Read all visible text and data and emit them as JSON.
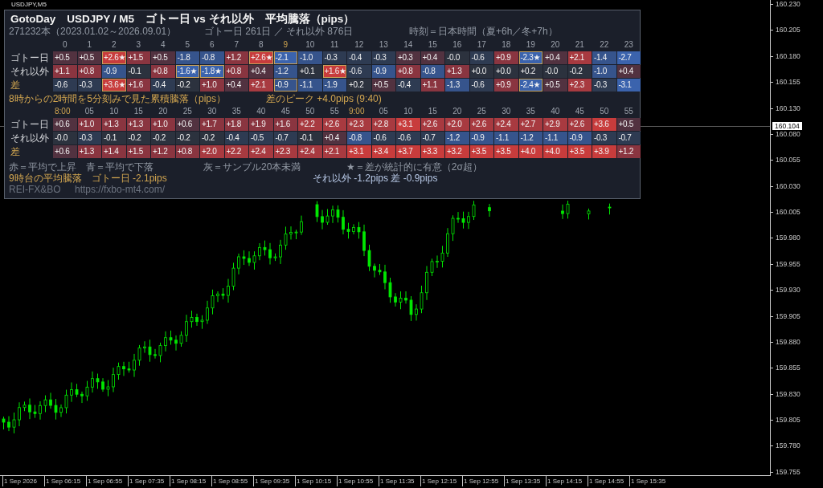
{
  "chart": {
    "symbol": "USDJPY,M5",
    "price_axis": [
      "160.230",
      "160.205",
      "160.180",
      "160.155",
      "160.130",
      "160.080",
      "160.055",
      "160.030",
      "160.005",
      "159.980",
      "159.955",
      "159.930",
      "159.905",
      "159.880",
      "159.855",
      "159.830",
      "159.805",
      "159.780",
      "159.755"
    ],
    "current_price": "160.104",
    "time_axis": [
      "1 Sep 2026",
      "1 Sep 06:15",
      "1 Sep 06:55",
      "1 Sep 07:35",
      "1 Sep 08:15",
      "1 Sep 08:55",
      "1 Sep 09:35",
      "1 Sep 10:15",
      "1 Sep 10:55",
      "1 Sep 11:35",
      "1 Sep 12:15",
      "1 Sep 12:55",
      "1 Sep 13:35",
      "1 Sep 14:15",
      "1 Sep 14:55",
      "1 Sep 15:35"
    ]
  },
  "panel": {
    "title": "GotoDay　USDJPY / M5　ゴトー日 vs それ以外　平均騰落（pips）",
    "bars": "271232本（2023.01.02～2026.09.01）",
    "days": "ゴトー日 261日 ／ それ以外 876日",
    "timezone": "時刻＝日本時間（夏+6h／冬+7h）",
    "hourly_table": {
      "columns": [
        {
          "label": "0",
          "highlighted": false
        },
        {
          "label": "1",
          "highlighted": false
        },
        {
          "label": "2",
          "highlighted": false
        },
        {
          "label": "3",
          "highlighted": false
        },
        {
          "label": "4",
          "highlighted": false
        },
        {
          "label": "5",
          "highlighted": false
        },
        {
          "label": "6",
          "highlighted": false
        },
        {
          "label": "7",
          "highlighted": false
        },
        {
          "label": "8",
          "highlighted": false
        },
        {
          "label": "9",
          "highlighted": true
        },
        {
          "label": "10",
          "highlighted": false
        },
        {
          "label": "11",
          "highlighted": false
        },
        {
          "label": "12",
          "highlighted": false
        },
        {
          "label": "13",
          "highlighted": false
        },
        {
          "label": "14",
          "highlighted": false
        },
        {
          "label": "15",
          "highlighted": false
        },
        {
          "label": "16",
          "highlighted": false
        },
        {
          "label": "17",
          "highlighted": false
        },
        {
          "label": "18",
          "highlighted": false
        },
        {
          "label": "19",
          "highlighted": false
        },
        {
          "label": "20",
          "highlighted": false
        },
        {
          "label": "21",
          "highlighted": false
        },
        {
          "label": "22",
          "highlighted": false
        },
        {
          "label": "23",
          "highlighted": false
        }
      ],
      "rows": [
        {
          "label": "ゴトー日",
          "highlighted": false,
          "cells": [
            {
              "text": "+0.5",
              "color": "#523240",
              "outlined": false
            },
            {
              "text": "+0.5",
              "color": "#523240",
              "outlined": false
            },
            {
              "text": "+2.6★",
              "color": "#c83c3c",
              "outlined": true
            },
            {
              "text": "+1.5",
              "color": "#8a3540",
              "outlined": false
            },
            {
              "text": "+0.5",
              "color": "#523240",
              "outlined": false
            },
            {
              "text": "-1.8",
              "color": "#36548c",
              "outlined": false
            },
            {
              "text": "-0.8",
              "color": "#36548c",
              "outlined": false
            },
            {
              "text": "+1.2",
              "color": "#8a3540",
              "outlined": false
            },
            {
              "text": "+2.6★",
              "color": "#c83c3c",
              "outlined": true
            },
            {
              "text": "-2.1",
              "color": "#3b63ad",
              "outlined": true
            },
            {
              "text": "-1.0",
              "color": "#36548c",
              "outlined": false
            },
            {
              "text": "-0.3",
              "color": "#2e3b52",
              "outlined": false
            },
            {
              "text": "-0.4",
              "color": "#2e3b52",
              "outlined": false
            },
            {
              "text": "-0.3",
              "color": "#2e3b52",
              "outlined": false
            },
            {
              "text": "+0.3",
              "color": "#523240",
              "outlined": false
            },
            {
              "text": "+0.4",
              "color": "#523240",
              "outlined": false
            },
            {
              "text": "-0.0",
              "color": "#2c323e",
              "outlined": false
            },
            {
              "text": "-0.6",
              "color": "#2e3b52",
              "outlined": false
            },
            {
              "text": "+0.9",
              "color": "#8a3540",
              "outlined": false
            },
            {
              "text": "-2.3★",
              "color": "#3b63ad",
              "outlined": true
            },
            {
              "text": "+0.4",
              "color": "#523240",
              "outlined": false
            },
            {
              "text": "+2.1",
              "color": "#a83a40",
              "outlined": false
            },
            {
              "text": "-1.4",
              "color": "#36548c",
              "outlined": false
            },
            {
              "text": "-2.7",
              "color": "#3b63ad",
              "outlined": false
            }
          ]
        },
        {
          "label": "それ以外",
          "highlighted": false,
          "cells": [
            {
              "text": "+1.1",
              "color": "#8a3540",
              "outlined": false
            },
            {
              "text": "+0.8",
              "color": "#8a3540",
              "outlined": false
            },
            {
              "text": "-0.9",
              "color": "#36548c",
              "outlined": false
            },
            {
              "text": "-0.1",
              "color": "#2c323e",
              "outlined": false
            },
            {
              "text": "+0.8",
              "color": "#8a3540",
              "outlined": false
            },
            {
              "text": "-1.6★",
              "color": "#3b63ad",
              "outlined": true
            },
            {
              "text": "-1.8★",
              "color": "#3b63ad",
              "outlined": true
            },
            {
              "text": "+0.8",
              "color": "#8a3540",
              "outlined": false
            },
            {
              "text": "+0.4",
              "color": "#523240",
              "outlined": false
            },
            {
              "text": "-1.2",
              "color": "#36548c",
              "outlined": false
            },
            {
              "text": "+0.1",
              "color": "#2c323e",
              "outlined": false
            },
            {
              "text": "+1.6★",
              "color": "#c83c3c",
              "outlined": true
            },
            {
              "text": "-0.6",
              "color": "#2e3b52",
              "outlined": false
            },
            {
              "text": "-0.9",
              "color": "#36548c",
              "outlined": false
            },
            {
              "text": "+0.8",
              "color": "#8a3540",
              "outlined": false
            },
            {
              "text": "-0.8",
              "color": "#36548c",
              "outlined": false
            },
            {
              "text": "+1.3",
              "color": "#8a3540",
              "outlined": false
            },
            {
              "text": "+0.0",
              "color": "#2c323e",
              "outlined": false
            },
            {
              "text": "+0.0",
              "color": "#2c323e",
              "outlined": false
            },
            {
              "text": "+0.2",
              "color": "#2c323e",
              "outlined": false
            },
            {
              "text": "-0.0",
              "color": "#2c323e",
              "outlined": false
            },
            {
              "text": "-0.2",
              "color": "#2c323e",
              "outlined": false
            },
            {
              "text": "-1.0",
              "color": "#36548c",
              "outlined": false
            },
            {
              "text": "+0.4",
              "color": "#523240",
              "outlined": false
            }
          ]
        },
        {
          "label": "差",
          "highlighted": true,
          "cells": [
            {
              "text": "-0.6",
              "color": "#2e3b52",
              "outlined": false
            },
            {
              "text": "-0.3",
              "color": "#2e3b52",
              "outlined": false
            },
            {
              "text": "+3.6★",
              "color": "#c83c3c",
              "outlined": true
            },
            {
              "text": "+1.6",
              "color": "#8a3540",
              "outlined": false
            },
            {
              "text": "-0.4",
              "color": "#2e3b52",
              "outlined": false
            },
            {
              "text": "-0.2",
              "color": "#2c323e",
              "outlined": false
            },
            {
              "text": "+1.0",
              "color": "#8a3540",
              "outlined": false
            },
            {
              "text": "+0.4",
              "color": "#523240",
              "outlined": false
            },
            {
              "text": "+2.1",
              "color": "#a83a40",
              "outlined": false
            },
            {
              "text": "-0.9",
              "color": "#36548c",
              "outlined": true
            },
            {
              "text": "-1.1",
              "color": "#36548c",
              "outlined": false
            },
            {
              "text": "-1.9",
              "color": "#36548c",
              "outlined": false
            },
            {
              "text": "+0.2",
              "color": "#2c323e",
              "outlined": false
            },
            {
              "text": "+0.5",
              "color": "#523240",
              "outlined": false
            },
            {
              "text": "-0.4",
              "color": "#2e3b52",
              "outlined": false
            },
            {
              "text": "+1.1",
              "color": "#8a3540",
              "outlined": false
            },
            {
              "text": "-1.3",
              "color": "#36548c",
              "outlined": false
            },
            {
              "text": "-0.6",
              "color": "#2e3b52",
              "outlined": false
            },
            {
              "text": "+0.9",
              "color": "#8a3540",
              "outlined": false
            },
            {
              "text": "-2.4★",
              "color": "#3b63ad",
              "outlined": true
            },
            {
              "text": "+0.5",
              "color": "#523240",
              "outlined": false
            },
            {
              "text": "+2.3",
              "color": "#a83a40",
              "outlined": false
            },
            {
              "text": "-0.3",
              "color": "#2e3b52",
              "outlined": false
            },
            {
              "text": "-3.1",
              "color": "#3b63ad",
              "outlined": false
            }
          ]
        }
      ]
    },
    "intraday_caption": "8時からの2時間を5分刻みで見た累積騰落（pips）",
    "peak": "差のピーク +4.0pips (9:40)",
    "intraday_table": {
      "columns": [
        {
          "label": "8:00",
          "highlighted": true
        },
        {
          "label": "05",
          "highlighted": false
        },
        {
          "label": "10",
          "highlighted": false
        },
        {
          "label": "15",
          "highlighted": false
        },
        {
          "label": "20",
          "highlighted": false
        },
        {
          "label": "25",
          "highlighted": false
        },
        {
          "label": "30",
          "highlighted": false
        },
        {
          "label": "35",
          "highlighted": false
        },
        {
          "label": "40",
          "highlighted": false
        },
        {
          "label": "45",
          "highlighted": false
        },
        {
          "label": "50",
          "highlighted": false
        },
        {
          "label": "55",
          "highlighted": false
        },
        {
          "label": "9:00",
          "highlighted": true
        },
        {
          "label": "05",
          "highlighted": false
        },
        {
          "label": "10",
          "highlighted": false
        },
        {
          "label": "15",
          "highlighted": false
        },
        {
          "label": "20",
          "highlighted": false
        },
        {
          "label": "25",
          "highlighted": false
        },
        {
          "label": "30",
          "highlighted": false
        },
        {
          "label": "35",
          "highlighted": false
        },
        {
          "label": "40",
          "highlighted": false
        },
        {
          "label": "45",
          "highlighted": false
        },
        {
          "label": "50",
          "highlighted": false
        },
        {
          "label": "55",
          "highlighted": false
        }
      ],
      "rows": [
        {
          "label": "ゴトー日",
          "highlighted": false,
          "cells": [
            {
              "text": "+0.6",
              "color": "#523240"
            },
            {
              "text": "+1.0",
              "color": "#8a3540"
            },
            {
              "text": "+1.3",
              "color": "#8a3540"
            },
            {
              "text": "+1.3",
              "color": "#8a3540"
            },
            {
              "text": "+1.0",
              "color": "#8a3540"
            },
            {
              "text": "+0.6",
              "color": "#523240"
            },
            {
              "text": "+1.7",
              "color": "#8a3540"
            },
            {
              "text": "+1.8",
              "color": "#8a3540"
            },
            {
              "text": "+1.9",
              "color": "#8a3540"
            },
            {
              "text": "+1.6",
              "color": "#8a3540"
            },
            {
              "text": "+2.2",
              "color": "#a83a40"
            },
            {
              "text": "+2.6",
              "color": "#a83a40"
            },
            {
              "text": "+2.3",
              "color": "#a83a40"
            },
            {
              "text": "+2.8",
              "color": "#a83a40"
            },
            {
              "text": "+3.1",
              "color": "#c83c3c"
            },
            {
              "text": "+2.6",
              "color": "#a83a40"
            },
            {
              "text": "+2.0",
              "color": "#a83a40"
            },
            {
              "text": "+2.6",
              "color": "#a83a40"
            },
            {
              "text": "+2.4",
              "color": "#a83a40"
            },
            {
              "text": "+2.7",
              "color": "#a83a40"
            },
            {
              "text": "+2.9",
              "color": "#a83a40"
            },
            {
              "text": "+2.6",
              "color": "#a83a40"
            },
            {
              "text": "+3.6",
              "color": "#c83c3c"
            },
            {
              "text": "+0.5",
              "color": "#523240"
            }
          ]
        },
        {
          "label": "それ以外",
          "highlighted": false,
          "cells": [
            {
              "text": "-0.0",
              "color": "#2c323e"
            },
            {
              "text": "-0.3",
              "color": "#2e3b52"
            },
            {
              "text": "-0.1",
              "color": "#2c323e"
            },
            {
              "text": "-0.2",
              "color": "#2c323e"
            },
            {
              "text": "-0.2",
              "color": "#2c323e"
            },
            {
              "text": "-0.2",
              "color": "#2c323e"
            },
            {
              "text": "-0.2",
              "color": "#2c323e"
            },
            {
              "text": "-0.4",
              "color": "#2e3b52"
            },
            {
              "text": "-0.5",
              "color": "#2e3b52"
            },
            {
              "text": "-0.7",
              "color": "#2e3b52"
            },
            {
              "text": "-0.1",
              "color": "#2c323e"
            },
            {
              "text": "+0.4",
              "color": "#523240"
            },
            {
              "text": "-0.8",
              "color": "#36548c"
            },
            {
              "text": "-0.6",
              "color": "#2e3b52"
            },
            {
              "text": "-0.6",
              "color": "#2e3b52"
            },
            {
              "text": "-0.7",
              "color": "#2e3b52"
            },
            {
              "text": "-1.2",
              "color": "#36548c"
            },
            {
              "text": "-0.9",
              "color": "#36548c"
            },
            {
              "text": "-1.1",
              "color": "#36548c"
            },
            {
              "text": "-1.2",
              "color": "#36548c"
            },
            {
              "text": "-1.1",
              "color": "#36548c"
            },
            {
              "text": "-0.9",
              "color": "#36548c"
            },
            {
              "text": "-0.3",
              "color": "#2e3b52"
            },
            {
              "text": "-0.7",
              "color": "#2e3b52"
            }
          ]
        },
        {
          "label": "差",
          "highlighted": true,
          "cells": [
            {
              "text": "+0.6",
              "color": "#523240"
            },
            {
              "text": "+1.3",
              "color": "#8a3540"
            },
            {
              "text": "+1.4",
              "color": "#8a3540"
            },
            {
              "text": "+1.5",
              "color": "#8a3540"
            },
            {
              "text": "+1.2",
              "color": "#8a3540"
            },
            {
              "text": "+0.8",
              "color": "#8a3540"
            },
            {
              "text": "+2.0",
              "color": "#a83a40"
            },
            {
              "text": "+2.2",
              "color": "#a83a40"
            },
            {
              "text": "+2.4",
              "color": "#a83a40"
            },
            {
              "text": "+2.3",
              "color": "#a83a40"
            },
            {
              "text": "+2.4",
              "color": "#a83a40"
            },
            {
              "text": "+2.1",
              "color": "#a83a40"
            },
            {
              "text": "+3.1",
              "color": "#c83c3c"
            },
            {
              "text": "+3.4",
              "color": "#c83c3c"
            },
            {
              "text": "+3.7",
              "color": "#c83c3c"
            },
            {
              "text": "+3.3",
              "color": "#c83c3c"
            },
            {
              "text": "+3.2",
              "color": "#c83c3c"
            },
            {
              "text": "+3.5",
              "color": "#c83c3c"
            },
            {
              "text": "+3.5",
              "color": "#c83c3c"
            },
            {
              "text": "+4.0",
              "color": "#c83c3c"
            },
            {
              "text": "+4.0",
              "color": "#c83c3c"
            },
            {
              "text": "+3.5",
              "color": "#c83c3c"
            },
            {
              "text": "+3.9",
              "color": "#c83c3c"
            },
            {
              "text": "+1.2",
              "color": "#8a3540"
            }
          ]
        }
      ]
    },
    "legend": [
      "赤＝平均で上昇　青＝平均で下落",
      "灰＝サンプル20本未満",
      "★＝差が統計的に有意（2σ超）"
    ],
    "summary_goto": "9時台の平均騰落　ゴトー日 -2.1pips",
    "summary_other": "それ以外 -1.2pips  差 -0.9pips",
    "author": "REI-FX&BO",
    "url": "https://fxbo-mt4.com/"
  }
}
